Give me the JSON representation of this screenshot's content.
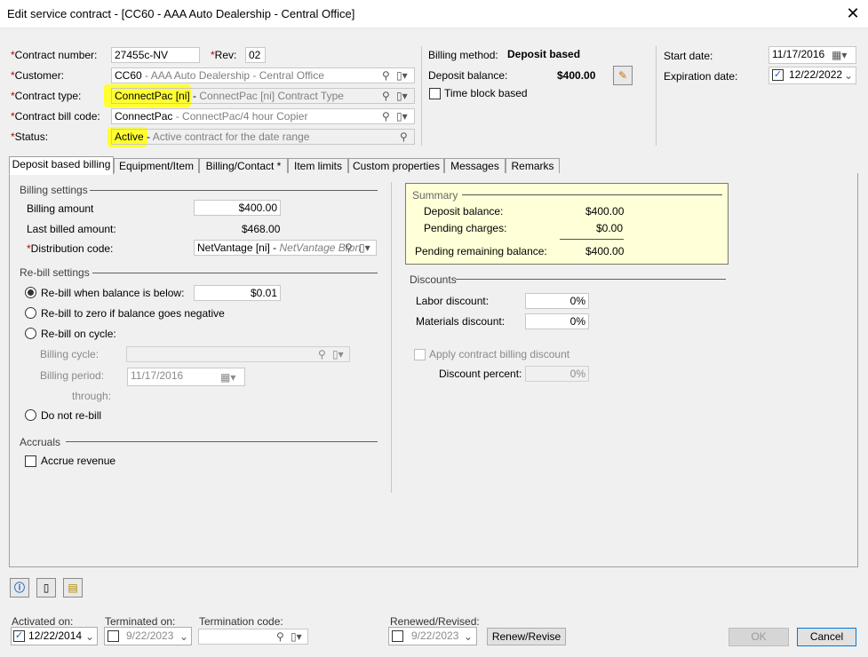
{
  "window": {
    "title": "Edit service contract - [CC60 - AAA Auto Dealership - Central Office]",
    "close_icon": "close-icon"
  },
  "header": {
    "contract_number_label": "Contract number:",
    "contract_number_value": "27455c-NV",
    "rev_label": "Rev:",
    "rev_value": "02",
    "customer_label": "Customer:",
    "customer_code": "CC60",
    "customer_desc": " - AAA Auto Dealership - Central Office",
    "contract_type_label": "Contract type:",
    "contract_type_code": "ConnectPac [ni] - ",
    "contract_type_desc": "ConnectPac [ni] Contract Type",
    "bill_code_label": "Contract bill code:",
    "bill_code_code": "ConnectPac",
    "bill_code_desc": " - ConnectPac/4 hour Copier",
    "status_label": "Status:",
    "status_code": "Active - ",
    "status_desc": "Active contract for the date range",
    "required_marker": "*"
  },
  "billing": {
    "method_label": "Billing method:",
    "method_value": "Deposit based",
    "deposit_balance_label": "Deposit balance:",
    "deposit_balance_value": "$400.00",
    "time_block_label": "Time block based"
  },
  "dates": {
    "start_label": "Start date:",
    "start_value": "11/17/2016",
    "expiration_label": "Expiration date:",
    "expiration_value": "12/22/2022"
  },
  "tabs": [
    {
      "label": "Deposit based billing"
    },
    {
      "label": "Equipment/Item"
    },
    {
      "label": "Billing/Contact *"
    },
    {
      "label": "Item limits"
    },
    {
      "label": "Custom properties"
    },
    {
      "label": "Messages"
    },
    {
      "label": "Remarks"
    }
  ],
  "billing_settings": {
    "title": "Billing settings",
    "billing_amount_label": "Billing amount",
    "billing_amount_value": "$400.00",
    "last_billed_label": "Last billed amount:",
    "last_billed_value": "$468.00",
    "distribution_label": "Distribution code:",
    "distribution_code": "NetVantage [ni] - ",
    "distribution_desc": "NetVantage Bron"
  },
  "rebill": {
    "title": "Re-bill settings",
    "below_label": "Re-bill when balance is below:",
    "below_value": "$0.01",
    "zero_label": "Re-bill to zero if balance goes negative",
    "cycle_label": "Re-bill on cycle:",
    "billing_cycle_label": "Billing cycle:",
    "billing_period_label": "Billing period:",
    "billing_period_value": "11/17/2016",
    "through_label": "through:",
    "no_rebill_label": "Do not re-bill"
  },
  "accruals": {
    "title": "Accruals",
    "accrue_label": "Accrue revenue"
  },
  "summary": {
    "title": "Summary",
    "deposit_label": "Deposit balance:",
    "deposit_value": "$400.00",
    "pending_label": "Pending charges:",
    "pending_value": "$0.00",
    "remaining_label": "Pending remaining balance:",
    "remaining_value": "$400.00"
  },
  "discounts": {
    "title": "Discounts",
    "labor_label": "Labor discount:",
    "labor_value": "0%",
    "materials_label": "Materials discount:",
    "materials_value": "0%",
    "apply_label": "Apply contract billing discount",
    "percent_label": "Discount percent:",
    "percent_value": "0%"
  },
  "footer": {
    "activated_label": "Activated on:",
    "activated_value": "12/22/2014",
    "terminated_label": "Terminated on:",
    "terminated_value": "9/22/2023",
    "termination_code_label": "Termination code:",
    "renewed_label": "Renewed/Revised:",
    "renewed_value": "9/22/2023",
    "renew_button": "Renew/Revise",
    "ok_button": "OK",
    "cancel_button": "Cancel"
  },
  "colors": {
    "highlight": "#ffff33",
    "summary_bg": "#ffffd8",
    "required": "#c00000"
  }
}
